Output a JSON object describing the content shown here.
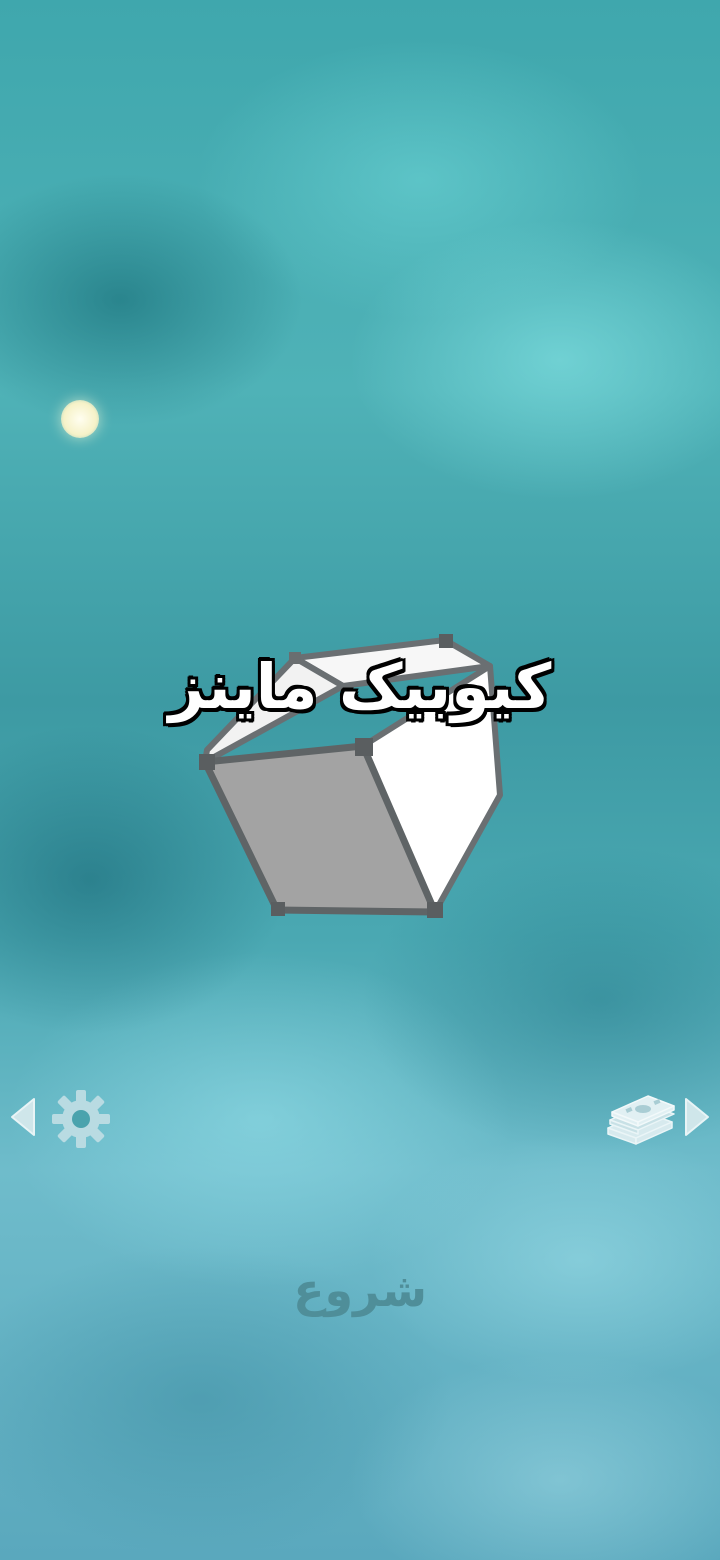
{
  "game": {
    "title": "کیوبیک ماینز",
    "start_label": "شروع"
  },
  "icons": {
    "settings": "gear-icon",
    "shop": "money-stack-icon",
    "prev": "triangle-left-icon",
    "next": "triangle-right-icon"
  },
  "colors": {
    "sky": "#47a9b0",
    "title_fill": "#ffffff",
    "title_outline": "#000000",
    "start_text": "#4f8e99",
    "cube_top": "#ffffff",
    "cube_front": "#9b9b9b",
    "cube_edge": "#5f6466"
  }
}
